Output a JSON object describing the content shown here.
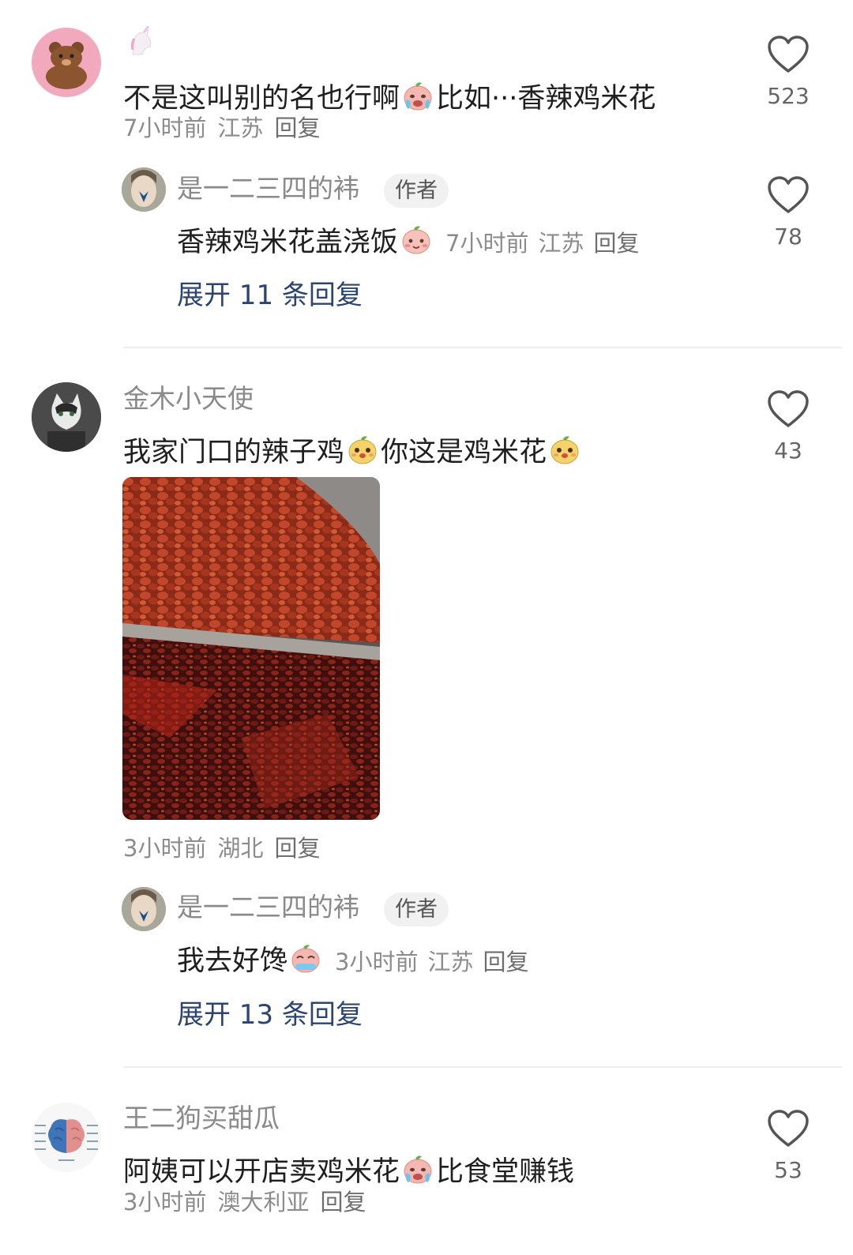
{
  "comments": [
    {
      "username": "",
      "text_a": "不是这叫别的名也行啊",
      "text_b": "比如···香辣鸡米花",
      "time": "7小时前",
      "location": "江苏",
      "reply_label": "回复",
      "likes": "523",
      "reply": {
        "username": "是一二三四的袆",
        "tag": "作者",
        "text": "香辣鸡米花盖浇饭",
        "time": "7小时前",
        "location": "江苏",
        "reply_label": "回复",
        "likes": "78"
      },
      "expand_label": "展开 11 条回复"
    },
    {
      "username": "金木小天使",
      "text_a": "我家门口的辣子鸡",
      "text_b": "你这是鸡米花",
      "time": "3小时前",
      "location": "湖北",
      "reply_label": "回复",
      "likes": "43",
      "reply": {
        "username": "是一二三四的袆",
        "tag": "作者",
        "text": "我去好馋",
        "time": "3小时前",
        "location": "江苏",
        "reply_label": "回复"
      },
      "expand_label": "展开 13 条回复"
    },
    {
      "username": "王二狗买甜瓜",
      "text_a": "阿姨可以开店卖鸡米花",
      "text_b": "比食堂赚钱",
      "time": "3小时前",
      "location": "澳大利亚",
      "reply_label": "回复",
      "likes": "53"
    }
  ],
  "icons": {
    "heart": "heart-outline-icon",
    "emoji_cry": "crying-peach-emoji",
    "emoji_smile": "peach-smile-emoji",
    "emoji_dog": "yellow-dog-emoji"
  },
  "colors": {
    "expand_link": "#2b4470",
    "meta_gray": "#8c8c8c",
    "divider": "#eeeeee"
  }
}
